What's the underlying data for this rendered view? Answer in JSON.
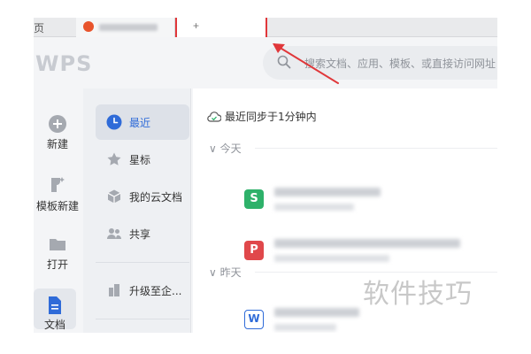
{
  "tabs": {
    "left_partial": "页",
    "new_tab_symbol": "+"
  },
  "brand": {
    "logo_text": "WPS"
  },
  "search": {
    "placeholder": "搜索文档、应用、模板、或直接访问网址"
  },
  "left_nav": [
    {
      "label": "新建",
      "icon": "plus-circle-icon"
    },
    {
      "label": "模板新建",
      "icon": "template-icon"
    },
    {
      "label": "打开",
      "icon": "folder-icon"
    },
    {
      "label": "文档",
      "icon": "document-icon"
    }
  ],
  "mid_nav": [
    {
      "label": "最近",
      "icon": "clock-icon",
      "active": true
    },
    {
      "label": "星标",
      "icon": "star-icon"
    },
    {
      "label": "我的云文档",
      "icon": "cube-icon"
    },
    {
      "label": "共享",
      "icon": "people-icon"
    },
    {
      "label": "升级至企...",
      "icon": "building-icon"
    }
  ],
  "main": {
    "sync_status": "最近同步于1分钟内",
    "group_today": "今天",
    "group_yesterday": "昨天",
    "file_icons": [
      "S",
      "P",
      "W"
    ]
  },
  "watermark": "软件技巧",
  "colors": {
    "accent": "#2f6bd8",
    "annotation_red": "#e0373a",
    "sheet_green": "#2eb16a",
    "pdf_red": "#e0484b"
  }
}
